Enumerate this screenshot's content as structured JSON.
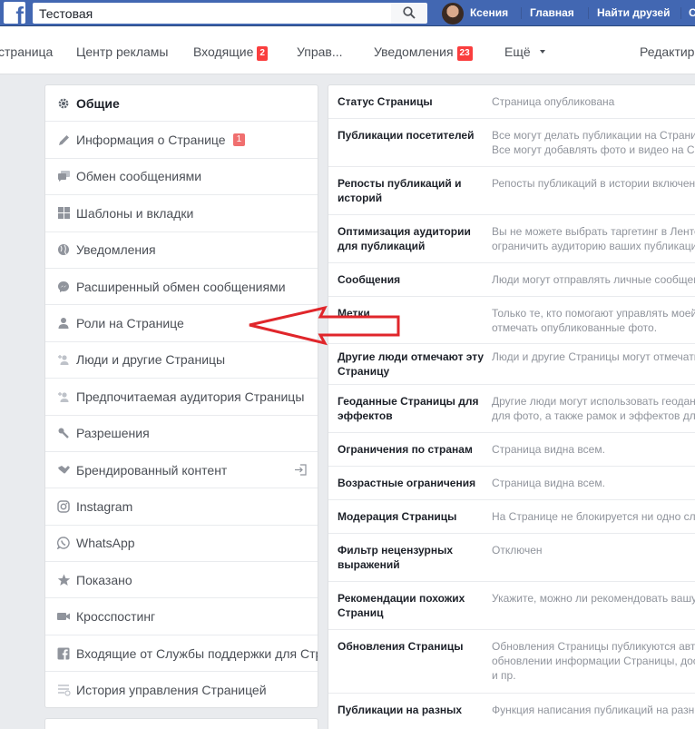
{
  "topbar": {
    "search_value": "Тестовая",
    "user_name": "Ксения",
    "home": "Главная",
    "find_friends": "Найти друзей",
    "extra": "С"
  },
  "pagenav": {
    "page": "страница",
    "ads_center": "Центр рекламы",
    "inbox": "Входящие",
    "inbox_count": "2",
    "manage": "Управ...",
    "notifications": "Уведомления",
    "notifications_count": "23",
    "more": "Ещё",
    "edit": "Редактир"
  },
  "menu": {
    "items": [
      {
        "label": "Общие",
        "icon": "gear-icon"
      },
      {
        "label": "Информация о Странице",
        "icon": "pencil-icon",
        "badge": "1"
      },
      {
        "label": "Обмен сообщениями",
        "icon": "chat-icon"
      },
      {
        "label": "Шаблоны и вкладки",
        "icon": "grid-icon"
      },
      {
        "label": "Уведомления",
        "icon": "globe-icon"
      },
      {
        "label": "Расширенный обмен сообщениями",
        "icon": "messenger-icon"
      },
      {
        "label": "Роли на Странице",
        "icon": "person-icon"
      },
      {
        "label": "Люди и другие Страницы",
        "icon": "person-add-icon"
      },
      {
        "label": "Предпочитаемая аудитория Страницы",
        "icon": "person-add-icon"
      },
      {
        "label": "Разрешения",
        "icon": "wrench-icon"
      },
      {
        "label": "Брендированный контент",
        "icon": "handshake-icon"
      },
      {
        "label": "Instagram",
        "icon": "instagram-icon"
      },
      {
        "label": "WhatsApp",
        "icon": "whatsapp-icon"
      },
      {
        "label": "Показано",
        "icon": "star-icon"
      },
      {
        "label": "Кросспостинг",
        "icon": "video-icon"
      },
      {
        "label": "Входящие от Службы поддержки для Стр",
        "icon": "facebook-icon"
      },
      {
        "label": "История управления Страницей",
        "icon": "list-icon"
      }
    ]
  },
  "settings": {
    "rows": [
      {
        "key": "Статус Страницы",
        "value": "Страница опубликована"
      },
      {
        "key": "Публикации посетителей",
        "value": "Все могут делать публикации на Страни\nВсе могут добавлять фото и видео на С"
      },
      {
        "key": "Репосты публикаций и историй",
        "value": "Репосты публикаций в истории включен"
      },
      {
        "key": "Оптимизация аудитории для публикаций",
        "value": "Вы не можете выбрать таргетинг в Ленте\nограничить аудиторию ваших публикаци"
      },
      {
        "key": "Сообщения",
        "value": "Люди могут отправлять личные сообщени"
      },
      {
        "key": "Метки",
        "value": "Только те, кто помогают управлять моей\nотмечать опубликованные фото."
      },
      {
        "key": "Другие люди отмечают эту Страницу",
        "value": "Люди и другие Страницы могут отмечать"
      },
      {
        "key": "Геоданные Страницы для эффектов",
        "value": "Другие люди могут использовать геодан\nдля фото, а также рамок и эффектов дл"
      },
      {
        "key": "Ограничения по странам",
        "value": "Страница видна всем."
      },
      {
        "key": "Возрастные ограничения",
        "value": "Страница видна всем."
      },
      {
        "key": "Модерация Страницы",
        "value": "На Странице не блокируется ни одно сл"
      },
      {
        "key": "Фильтр нецензурных выражений",
        "value": "Отключен"
      },
      {
        "key": "Рекомендации похожих Страниц",
        "value": "Укажите, можно ли рекомендовать вашу"
      },
      {
        "key": "Обновления Страницы",
        "value": "Обновления Страницы публикуются авт\nобновлении информации Страницы, дос\nи пр."
      },
      {
        "key": "Публикации на разных",
        "value": "Функция написания публикаций на разн"
      }
    ]
  },
  "colors": {
    "brand": "#4267b2",
    "badge": "#fa3e3e",
    "arrow": "#e0262b"
  }
}
